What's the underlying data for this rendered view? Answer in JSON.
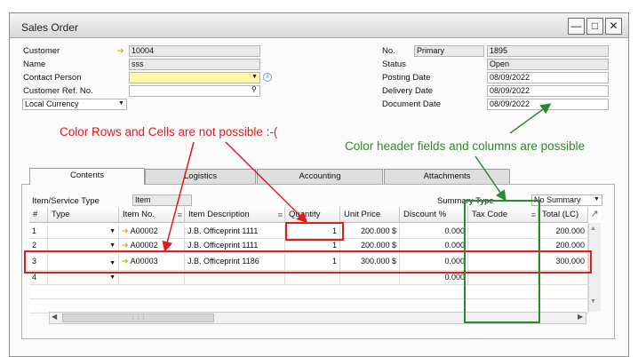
{
  "window": {
    "title": "Sales Order"
  },
  "header": {
    "customer_label": "Customer",
    "customer_value": "10004",
    "name_label": "Name",
    "name_value": "sss",
    "contact_label": "Contact Person",
    "contact_value": "",
    "ref_label": "Customer Ref. No.",
    "ref_value": "",
    "currency_value": "Local Currency",
    "no_label": "No.",
    "series_value": "Primary",
    "no_value": "1895",
    "status_label": "Status",
    "status_value": "Open",
    "posting_label": "Posting Date",
    "posting_value": "08/09/2022",
    "delivery_label": "Delivery Date",
    "delivery_value": "08/09/2022",
    "document_label": "Document Date",
    "document_value": "08/09/2022"
  },
  "annotations": {
    "red": "Color Rows and Cells are not possible :-(",
    "green": "Color header fields and columns are possible"
  },
  "tabs": [
    {
      "label": "Contents"
    },
    {
      "label": "Logistics"
    },
    {
      "label": "Accounting"
    },
    {
      "label": "Attachments"
    }
  ],
  "contents": {
    "item_type_label": "Item/Service Type",
    "item_type_value": "Item",
    "summary_label": "Summary Type",
    "summary_value": "No Summary"
  },
  "table": {
    "columns": [
      "#",
      "Type",
      "Item No.",
      "Item Description",
      "Quantity",
      "Unit Price",
      "Discount %",
      "Tax Code",
      "Total (LC)"
    ],
    "rows": [
      {
        "num": "1",
        "item_no": "A00002",
        "desc": "J.B. Officeprint 1111",
        "qty": "1",
        "price": "200.000 $",
        "disc": "0.000",
        "total": "200.000"
      },
      {
        "num": "2",
        "item_no": "A00002",
        "desc": "J.B. Officeprint 1111",
        "qty": "1",
        "price": "200.000 $",
        "disc": "0.000",
        "total": "200.000"
      },
      {
        "num": "3",
        "item_no": "A00003",
        "desc": "J.B. Officeprint 1186",
        "qty": "1",
        "price": "300.000 $",
        "disc": "0.000",
        "total": "300.000"
      },
      {
        "num": "4",
        "item_no": "",
        "desc": "",
        "qty": "",
        "price": "",
        "disc": "0.000",
        "total": ""
      }
    ]
  },
  "colors": {
    "annotation_red": "#e11c1c",
    "annotation_green": "#2b8a2b",
    "mandatory_field": "#fff6a8"
  },
  "icons": [
    "minimize-icon",
    "maximize-icon",
    "close-icon",
    "link-arrow-icon",
    "dropdown-icon",
    "search-icon",
    "sort-icon",
    "scroll-left-icon",
    "scroll-right-icon",
    "scroll-up-icon",
    "scroll-down-icon",
    "expand-icon"
  ]
}
